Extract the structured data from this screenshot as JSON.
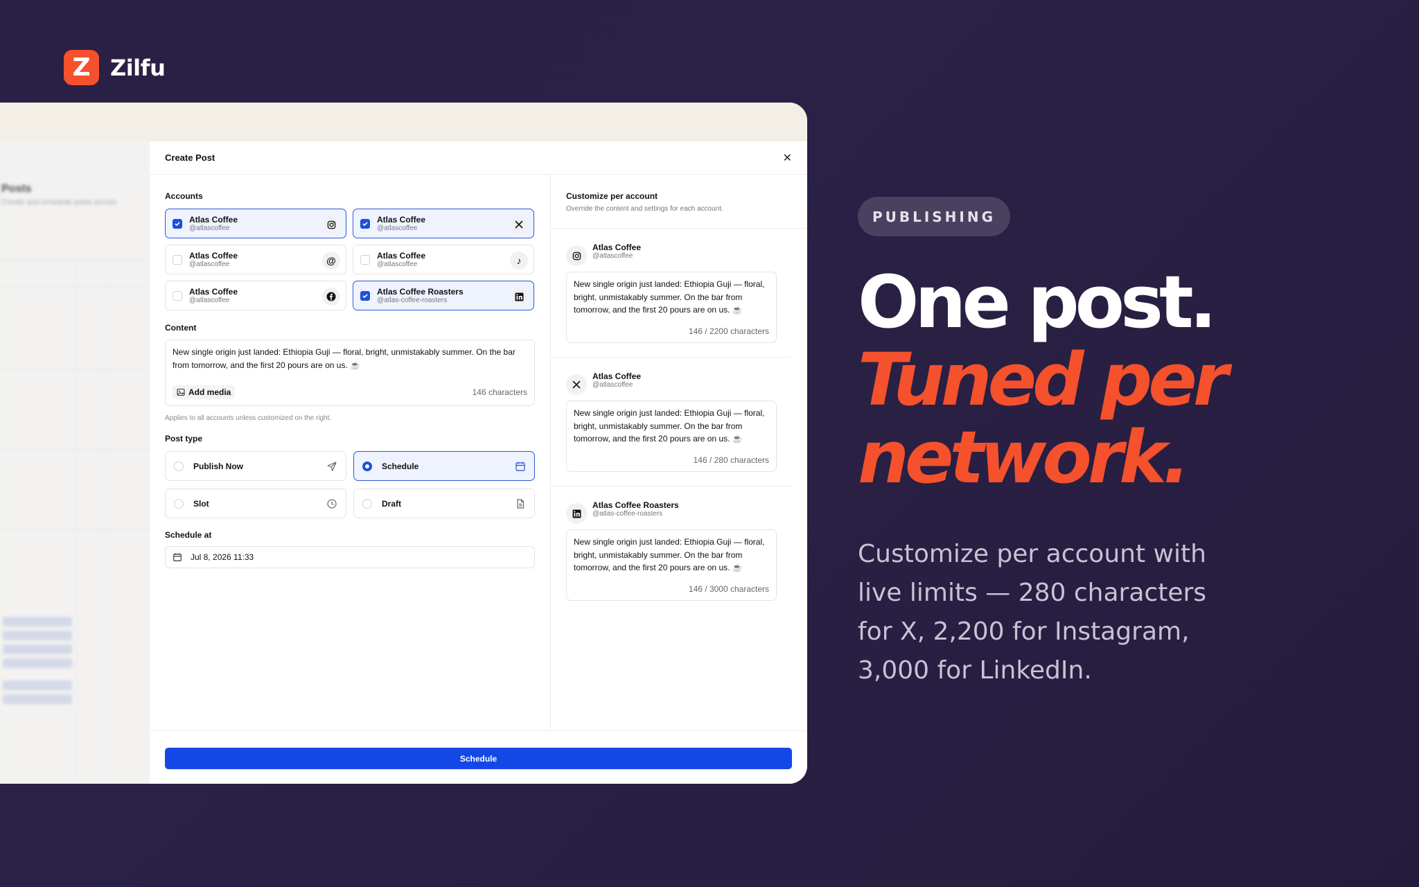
{
  "brand": {
    "name": "Zilfu",
    "logo_letter": "Z",
    "accent": "#f4512c"
  },
  "modal": {
    "title": "Create Post",
    "accounts_label": "Accounts",
    "accounts": [
      {
        "name": "Atlas Coffee",
        "handle": "@atlascoffee",
        "network": "instagram",
        "selected": true
      },
      {
        "name": "Atlas Coffee",
        "handle": "@atlascoffee",
        "network": "x",
        "selected": true
      },
      {
        "name": "Atlas Coffee",
        "handle": "@atlascoffee",
        "network": "threads",
        "selected": false
      },
      {
        "name": "Atlas Coffee",
        "handle": "@atlascoffee",
        "network": "tiktok",
        "selected": false
      },
      {
        "name": "Atlas Coffee",
        "handle": "@atlascoffee",
        "network": "facebook",
        "selected": false
      },
      {
        "name": "Atlas Coffee Roasters",
        "handle": "@atlas-coffee-roasters",
        "network": "linkedin",
        "selected": true
      }
    ],
    "content_label": "Content",
    "content_text": "New single origin just landed: Ethiopia Guji — floral, bright, unmistakably summer. On the bar from tomorrow, and the first 20 pours are on us. ☕",
    "add_media": "Add media",
    "char_count": "146 characters",
    "hint": "Applies to all accounts unless customized on the right.",
    "post_type_label": "Post type",
    "post_types": [
      {
        "label": "Publish Now",
        "icon": "send-icon",
        "selected": false
      },
      {
        "label": "Schedule",
        "icon": "calendar-icon",
        "selected": true
      },
      {
        "label": "Slot",
        "icon": "clock-icon",
        "selected": false
      },
      {
        "label": "Draft",
        "icon": "file-icon",
        "selected": false
      }
    ],
    "schedule_label": "Schedule at",
    "schedule_value": "Jul 8, 2026 11:33",
    "submit": "Schedule",
    "primary_color": "#1448e6"
  },
  "customize": {
    "title": "Customize per account",
    "subtitle": "Override the content and settings for each account.",
    "cards": [
      {
        "name": "Atlas Coffee",
        "handle": "@atlascoffee",
        "network": "instagram",
        "count": "146 / 2200 characters"
      },
      {
        "name": "Atlas Coffee",
        "handle": "@atlascoffee",
        "network": "x",
        "count": "146 / 280 characters"
      },
      {
        "name": "Atlas Coffee Roasters",
        "handle": "@atlas-coffee-roasters",
        "network": "linkedin",
        "count": "146 / 3000 characters"
      }
    ]
  },
  "marketing": {
    "pill": "PUBLISHING",
    "headline_1": "One post.",
    "headline_2": "Tuned per",
    "headline_3": "network.",
    "subtext": "Customize per account with live limits — 280 characters for X, 2,200 for Instagram, 3,000 for LinkedIn."
  }
}
